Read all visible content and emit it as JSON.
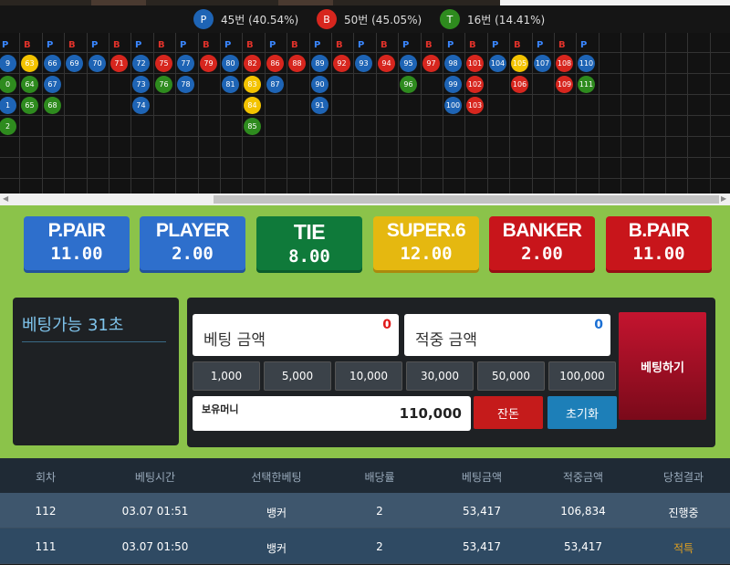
{
  "stats": {
    "player": {
      "glyph": "P",
      "text": "45번 (40.54%)",
      "color": "#1e64b5"
    },
    "banker": {
      "glyph": "B",
      "text": "50번 (45.05%)",
      "color": "#d7261e"
    },
    "tie": {
      "glyph": "T",
      "text": "16번 (14.41%)",
      "color": "#2e8b1e"
    }
  },
  "road": {
    "header": [
      "P",
      "B",
      "P",
      "B",
      "P",
      "B",
      "P",
      "B",
      "P",
      "B",
      "P",
      "B",
      "P",
      "B",
      "P",
      "B",
      "P",
      "B",
      "P",
      "B",
      "P",
      "B",
      "P",
      "B",
      "P",
      "B",
      "P"
    ],
    "columns": [
      {
        "items": [
          {
            "n": "9",
            "c": "P"
          },
          {
            "n": "0",
            "c": "T"
          },
          {
            "n": "1",
            "c": "P"
          },
          {
            "n": "2",
            "c": "T"
          }
        ]
      },
      {
        "items": [
          {
            "n": "63",
            "c": "S"
          },
          {
            "n": "64",
            "c": "T"
          },
          {
            "n": "65",
            "c": "T"
          }
        ]
      },
      {
        "items": [
          {
            "n": "66",
            "c": "P"
          },
          {
            "n": "67",
            "c": "P"
          },
          {
            "n": "68",
            "c": "T"
          }
        ]
      },
      {
        "items": [
          {
            "n": "69",
            "c": "P"
          }
        ]
      },
      {
        "items": [
          {
            "n": "70",
            "c": "P"
          }
        ]
      },
      {
        "items": [
          {
            "n": "71",
            "c": "B"
          }
        ]
      },
      {
        "items": [
          {
            "n": "72",
            "c": "P"
          },
          {
            "n": "73",
            "c": "P"
          },
          {
            "n": "74",
            "c": "P"
          }
        ]
      },
      {
        "items": [
          {
            "n": "75",
            "c": "B"
          },
          {
            "n": "76",
            "c": "T"
          }
        ]
      },
      {
        "items": [
          {
            "n": "77",
            "c": "P"
          },
          {
            "n": "78",
            "c": "P"
          }
        ]
      },
      {
        "items": [
          {
            "n": "79",
            "c": "B"
          }
        ]
      },
      {
        "items": [
          {
            "n": "80",
            "c": "P"
          },
          {
            "n": "81",
            "c": "P"
          }
        ]
      },
      {
        "items": [
          {
            "n": "82",
            "c": "B"
          },
          {
            "n": "83",
            "c": "S"
          },
          {
            "n": "84",
            "c": "S"
          },
          {
            "n": "85",
            "c": "T"
          }
        ]
      },
      {
        "items": [
          {
            "n": "86",
            "c": "B"
          },
          {
            "n": "87",
            "c": "P"
          }
        ]
      },
      {
        "items": [
          {
            "n": "88",
            "c": "B"
          }
        ]
      },
      {
        "items": [
          {
            "n": "89",
            "c": "P"
          },
          {
            "n": "90",
            "c": "P"
          },
          {
            "n": "91",
            "c": "P"
          }
        ]
      },
      {
        "items": [
          {
            "n": "92",
            "c": "B"
          }
        ]
      },
      {
        "items": [
          {
            "n": "93",
            "c": "P"
          }
        ]
      },
      {
        "items": [
          {
            "n": "94",
            "c": "B"
          }
        ]
      },
      {
        "items": [
          {
            "n": "95",
            "c": "P"
          },
          {
            "n": "96",
            "c": "T"
          }
        ]
      },
      {
        "items": [
          {
            "n": "97",
            "c": "B"
          }
        ]
      },
      {
        "items": [
          {
            "n": "98",
            "c": "P"
          },
          {
            "n": "99",
            "c": "P"
          },
          {
            "n": "100",
            "c": "P"
          }
        ]
      },
      {
        "items": [
          {
            "n": "101",
            "c": "B"
          },
          {
            "n": "102",
            "c": "B"
          },
          {
            "n": "103",
            "c": "B"
          }
        ]
      },
      {
        "items": [
          {
            "n": "104",
            "c": "P"
          }
        ]
      },
      {
        "items": [
          {
            "n": "105",
            "c": "S"
          },
          {
            "n": "106",
            "c": "B"
          }
        ]
      },
      {
        "items": [
          {
            "n": "107",
            "c": "P"
          }
        ]
      },
      {
        "items": [
          {
            "n": "108",
            "c": "B"
          },
          {
            "n": "109",
            "c": "B"
          }
        ]
      },
      {
        "items": [
          {
            "n": "110",
            "c": "P"
          },
          {
            "n": "111",
            "c": "T"
          }
        ]
      }
    ],
    "colors": {
      "P": "#1e64b5",
      "B": "#d7261e",
      "T": "#2e8b1e",
      "S": "#f3c300"
    }
  },
  "bets": [
    {
      "name": "P.PAIR",
      "odds": "11.00",
      "color": "#2e6fcc"
    },
    {
      "name": "PLAYER",
      "odds": "2.00",
      "color": "#2e6fcc"
    },
    {
      "name": "TIE",
      "odds": "8.00",
      "color": "#0f7a3a"
    },
    {
      "name": "SUPER.6",
      "odds": "12.00",
      "color": "#e5b810"
    },
    {
      "name": "BANKER",
      "odds": "2.00",
      "color": "#c8151b"
    },
    {
      "name": "B.PAIR",
      "odds": "11.00",
      "color": "#c8151b"
    }
  ],
  "betting": {
    "timer": "베팅가능 31초",
    "bet_amount_label": "베팅 금액",
    "bet_amount_value": "0",
    "win_amount_label": "적중 금액",
    "win_amount_value": "0",
    "chips": [
      "1,000",
      "5,000",
      "10,000",
      "30,000",
      "50,000",
      "100,000"
    ],
    "balance_label": "보유머니",
    "balance_value": "110,000",
    "remainder_button": "잔돈",
    "reset_button": "초기화",
    "bet_button": "베팅하기"
  },
  "history": {
    "headers": [
      "회차",
      "베팅시간",
      "선택한베팅",
      "배당률",
      "베팅금액",
      "적중금액",
      "당첨결과"
    ],
    "rows": [
      {
        "cells": [
          "112",
          "03.07 01:51",
          "뱅커",
          "2",
          "53,417",
          "106,834",
          "진행중"
        ],
        "bg": "#3e566d",
        "result_color": "#ffffff"
      },
      {
        "cells": [
          "111",
          "03.07 01:50",
          "뱅커",
          "2",
          "53,417",
          "53,417",
          "적특"
        ],
        "bg": "#2f4a63",
        "result_color": "#e0a020"
      }
    ]
  }
}
